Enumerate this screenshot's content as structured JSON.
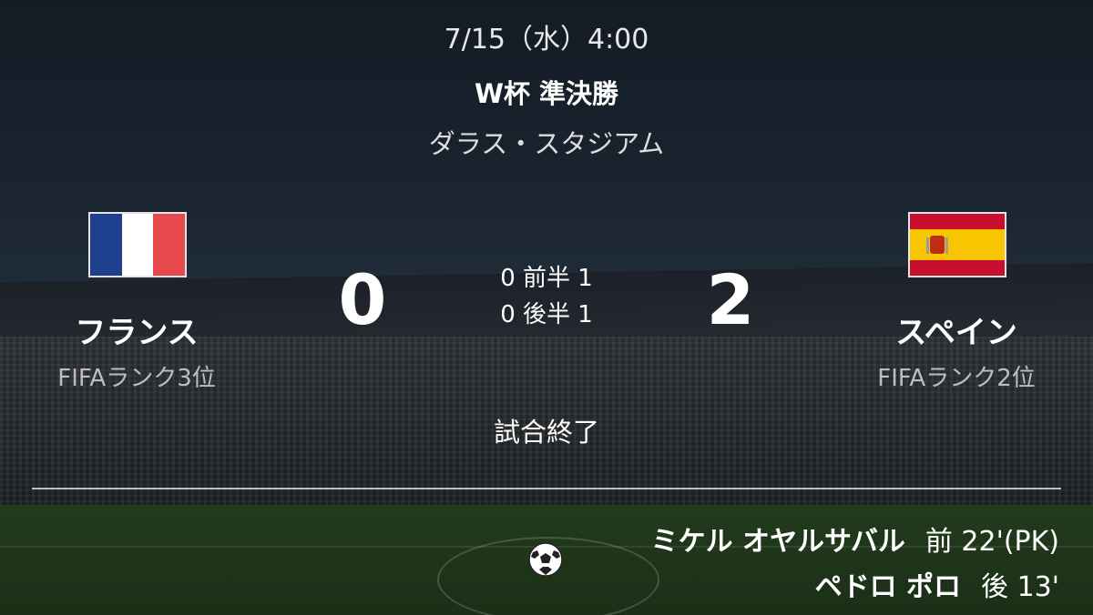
{
  "match": {
    "date": "7/15（水）4:00",
    "competition": "W杯 準決勝",
    "venue": "ダラス・スタジアム",
    "status": "試合終了"
  },
  "home": {
    "name": "フランス",
    "rank": "FIFAランク3位",
    "score": "0",
    "flag_colors": [
      "#1f3f8f",
      "#ffffff",
      "#e5484d"
    ]
  },
  "away": {
    "name": "スペイン",
    "rank": "FIFAランク2位",
    "score": "2",
    "flag_colors": [
      "#c8102e",
      "#f7c600"
    ]
  },
  "halves": {
    "first": "0 前半 1",
    "second": "0 後半 1"
  },
  "scorers": [
    {
      "player": "ミケル オヤルサバル",
      "time": "前 22'(PK)"
    },
    {
      "player": "ペドロ ポロ",
      "time": "後 13'"
    }
  ],
  "icons": {
    "goal": "soccer-ball-icon"
  }
}
